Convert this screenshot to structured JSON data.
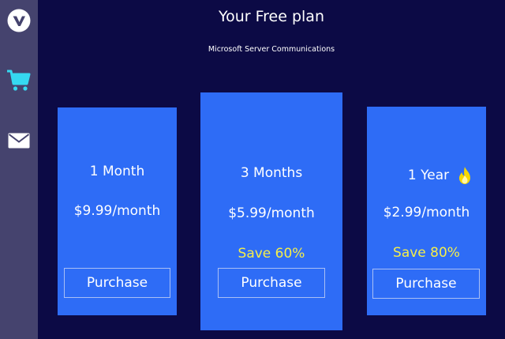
{
  "header": {
    "title": "Your Free plan",
    "subtitle": "Microsoft Server Communications"
  },
  "sidebar": {
    "items": [
      {
        "icon": "logo-v-icon"
      },
      {
        "icon": "cart-icon",
        "color": "#35d8f0"
      },
      {
        "icon": "mail-icon"
      }
    ]
  },
  "plans": [
    {
      "duration": "1 Month",
      "price": "$9.99/month",
      "savings": "",
      "button": "Purchase"
    },
    {
      "duration": "3 Months",
      "price": "$5.99/month",
      "savings": "Save 60%",
      "button": "Purchase"
    },
    {
      "duration": "1 Year",
      "price": "$2.99/month",
      "savings": "Save 80%",
      "button": "Purchase",
      "badge_icon": "fire-icon"
    }
  ],
  "colors": {
    "background": "#0c0a45",
    "sidebar": "#45436e",
    "card": "#2e6cf6",
    "savings_text": "#f5ee4a",
    "accent_cart": "#35d8f0"
  }
}
